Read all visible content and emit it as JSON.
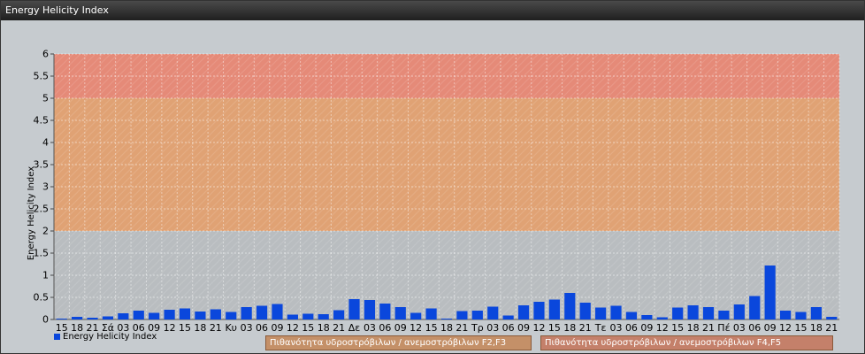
{
  "window": {
    "title": "Energy Helicity Index"
  },
  "colors": {
    "bar": "#0a47dc",
    "band_low": "#b9bdc0",
    "band_mid": "#e0a274",
    "band_high": "#e58a78",
    "legend_mid": "#c49068",
    "legend_high": "#c4806a"
  },
  "legend": {
    "series_label": "Energy Helicity Index",
    "band_mid_label": "Πιθανότητα υδροστρόβιλων / ανεμοστρόβιλων F2,F3",
    "band_high_label": "Πιθανότητα υδροστρόβιλων / ανεμοστρόβιλων F4,F5"
  },
  "chart_data": {
    "type": "bar",
    "title": "",
    "xlabel": "",
    "ylabel": "Energy Helicity Index",
    "ylim": [
      0,
      6
    ],
    "yticks": [
      "0",
      "0.5",
      "1",
      "1.5",
      "2",
      "2.5",
      "3",
      "3.5",
      "4",
      "4.5",
      "5",
      "5.5",
      "6"
    ],
    "grid": true,
    "legend_position": "bottom-left",
    "bands": [
      {
        "from": 0,
        "to": 2,
        "color": "#b9bdc0"
      },
      {
        "from": 2,
        "to": 5,
        "color": "#e0a274",
        "label": "Πιθανότητα υδροστρόβιλων / ανεμοστρόβιλων F2,F3"
      },
      {
        "from": 5,
        "to": 6,
        "color": "#e58a78",
        "label": "Πιθανότητα υδροστρόβιλων / ανεμοστρόβιλων F4,F5"
      }
    ],
    "categories": [
      "15",
      "18",
      "21",
      "Σά",
      "03",
      "06",
      "09",
      "12",
      "15",
      "18",
      "21",
      "Κυ",
      "03",
      "06",
      "09",
      "12",
      "15",
      "18",
      "21",
      "Δε",
      "03",
      "06",
      "09",
      "12",
      "15",
      "18",
      "21",
      "Τρ",
      "03",
      "06",
      "09",
      "12",
      "15",
      "18",
      "21",
      "Τε",
      "03",
      "06",
      "09",
      "12",
      "15",
      "18",
      "21",
      "Πέ",
      "03",
      "06",
      "09",
      "12",
      "15",
      "18",
      "21"
    ],
    "series": [
      {
        "name": "Energy Helicity Index",
        "values": [
          0.02,
          0.06,
          0.04,
          0.07,
          0.14,
          0.2,
          0.15,
          0.22,
          0.25,
          0.18,
          0.23,
          0.17,
          0.28,
          0.31,
          0.35,
          0.11,
          0.13,
          0.12,
          0.21,
          0.46,
          0.44,
          0.36,
          0.28,
          0.15,
          0.25,
          0.02,
          0.19,
          0.2,
          0.29,
          0.09,
          0.32,
          0.4,
          0.45,
          0.6,
          0.38,
          0.27,
          0.31,
          0.17,
          0.1,
          0.05,
          0.27,
          0.32,
          0.28,
          0.2,
          0.34,
          0.53,
          1.22,
          0.2,
          0.17,
          0.28,
          0.06
        ]
      }
    ]
  }
}
